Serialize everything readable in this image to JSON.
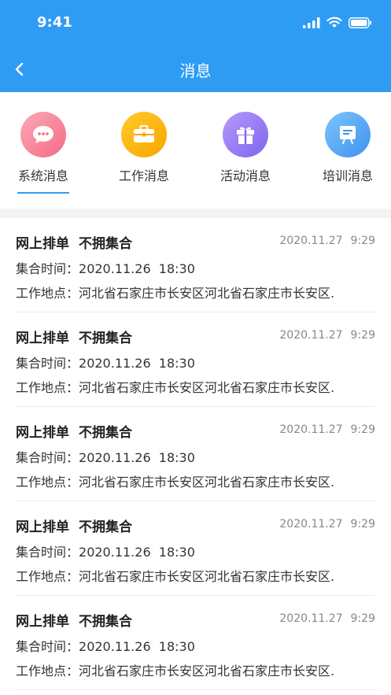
{
  "status": {
    "time": "9:41"
  },
  "nav": {
    "title": "消息"
  },
  "categories": [
    {
      "label": "系统消息",
      "icon": "chat-bubble-icon",
      "color": "#f7708a",
      "active": true
    },
    {
      "label": "工作消息",
      "icon": "briefcase-icon",
      "color": "#fbb300",
      "active": false
    },
    {
      "label": "活动消息",
      "icon": "gift-icon",
      "color": "#9a7cf4",
      "active": false
    },
    {
      "label": "培训消息",
      "icon": "board-icon",
      "color": "#4aa3f5",
      "active": false
    }
  ],
  "messages": [
    {
      "title_a": "网上排单",
      "title_b": "不拥集合",
      "date": "2020.11.27",
      "time": "9:29",
      "gather_label": "集合时间：",
      "gather_date": "2020.11.26",
      "gather_time": "18:30",
      "place_label": "工作地点：",
      "place": "河北省石家庄市长安区河北省石家庄市长安区."
    },
    {
      "title_a": "网上排单",
      "title_b": "不拥集合",
      "date": "2020.11.27",
      "time": "9:29",
      "gather_label": "集合时间：",
      "gather_date": "2020.11.26",
      "gather_time": "18:30",
      "place_label": "工作地点：",
      "place": "河北省石家庄市长安区河北省石家庄市长安区."
    },
    {
      "title_a": "网上排单",
      "title_b": "不拥集合",
      "date": "2020.11.27",
      "time": "9:29",
      "gather_label": "集合时间：",
      "gather_date": "2020.11.26",
      "gather_time": "18:30",
      "place_label": "工作地点：",
      "place": "河北省石家庄市长安区河北省石家庄市长安区."
    },
    {
      "title_a": "网上排单",
      "title_b": "不拥集合",
      "date": "2020.11.27",
      "time": "9:29",
      "gather_label": "集合时间：",
      "gather_date": "2020.11.26",
      "gather_time": "18:30",
      "place_label": "工作地点：",
      "place": "河北省石家庄市长安区河北省石家庄市长安区."
    },
    {
      "title_a": "网上排单",
      "title_b": "不拥集合",
      "date": "2020.11.27",
      "time": "9:29",
      "gather_label": "集合时间：",
      "gather_date": "2020.11.26",
      "gather_time": "18:30",
      "place_label": "工作地点：",
      "place": "河北省石家庄市长安区河北省石家庄市长安区."
    }
  ]
}
